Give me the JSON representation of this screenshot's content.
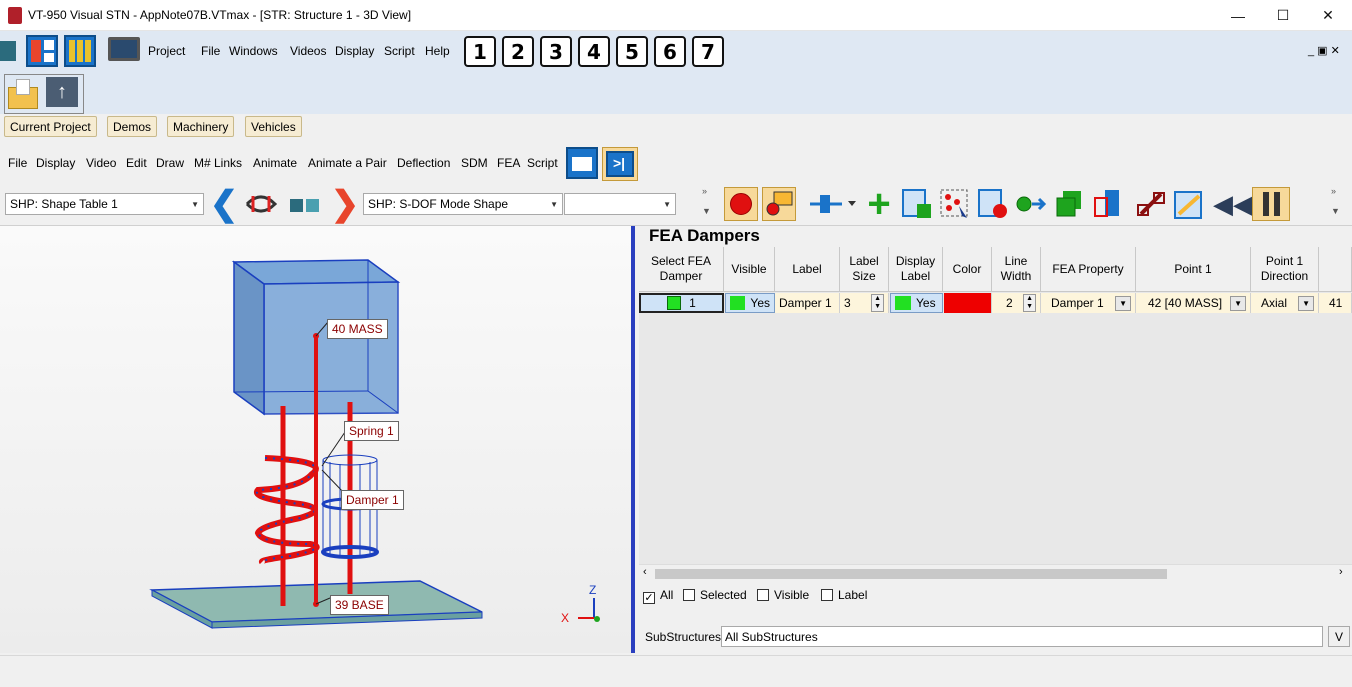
{
  "window": {
    "title": "VT-950 Visual STN - AppNote07B.VTmax - [STR: Structure 1 - 3D View]",
    "minimize": "—",
    "maximize": "☐",
    "close": "✕"
  },
  "menu1": [
    "Project",
    "File",
    "Windows",
    "Videos",
    "Display",
    "Script",
    "Help"
  ],
  "number_buttons": [
    "1",
    "2",
    "3",
    "4",
    "5",
    "6",
    "7"
  ],
  "project_tabs": [
    "Current Project",
    "Demos",
    "Machinery",
    "Vehicles"
  ],
  "menu2": [
    "File",
    "Display",
    "Video",
    "Edit",
    "Draw",
    "M# Links",
    "Animate",
    "Animate a Pair",
    "Deflection",
    "SDM",
    "FEA",
    "Script"
  ],
  "toolbar": {
    "shape_table": "SHP: Shape Table 1",
    "mode_shape": "SHP: S-DOF Mode Shape",
    "extra_combo": ""
  },
  "view3d": {
    "labels": {
      "mass": "40 MASS",
      "spring": "Spring 1",
      "damper": "Damper 1",
      "base": "39 BASE"
    },
    "axes": {
      "z": "Z",
      "x": "X"
    }
  },
  "panel": {
    "title": "FEA Dampers",
    "columns": [
      "Select FEA Damper",
      "Visible",
      "Label",
      "Label Size",
      "Display Label",
      "Color",
      "Line Width",
      "FEA Property",
      "Point 1",
      "Point 1 Direction",
      ""
    ],
    "row": {
      "select": "1",
      "visible": "Yes",
      "label": "Damper 1",
      "label_size": "3",
      "display_label": "Yes",
      "color": "#ee0000",
      "line_width": "2",
      "fea_property": "Damper 1",
      "point1": "42 [40 MASS]",
      "point1_dir": "Axial",
      "next": "41"
    },
    "filters": {
      "all": "All",
      "selected": "Selected",
      "visible": "Visible",
      "label": "Label"
    },
    "substructures_label": "SubStructures",
    "substructures_value": "All SubStructures",
    "substructures_btn": "V"
  }
}
